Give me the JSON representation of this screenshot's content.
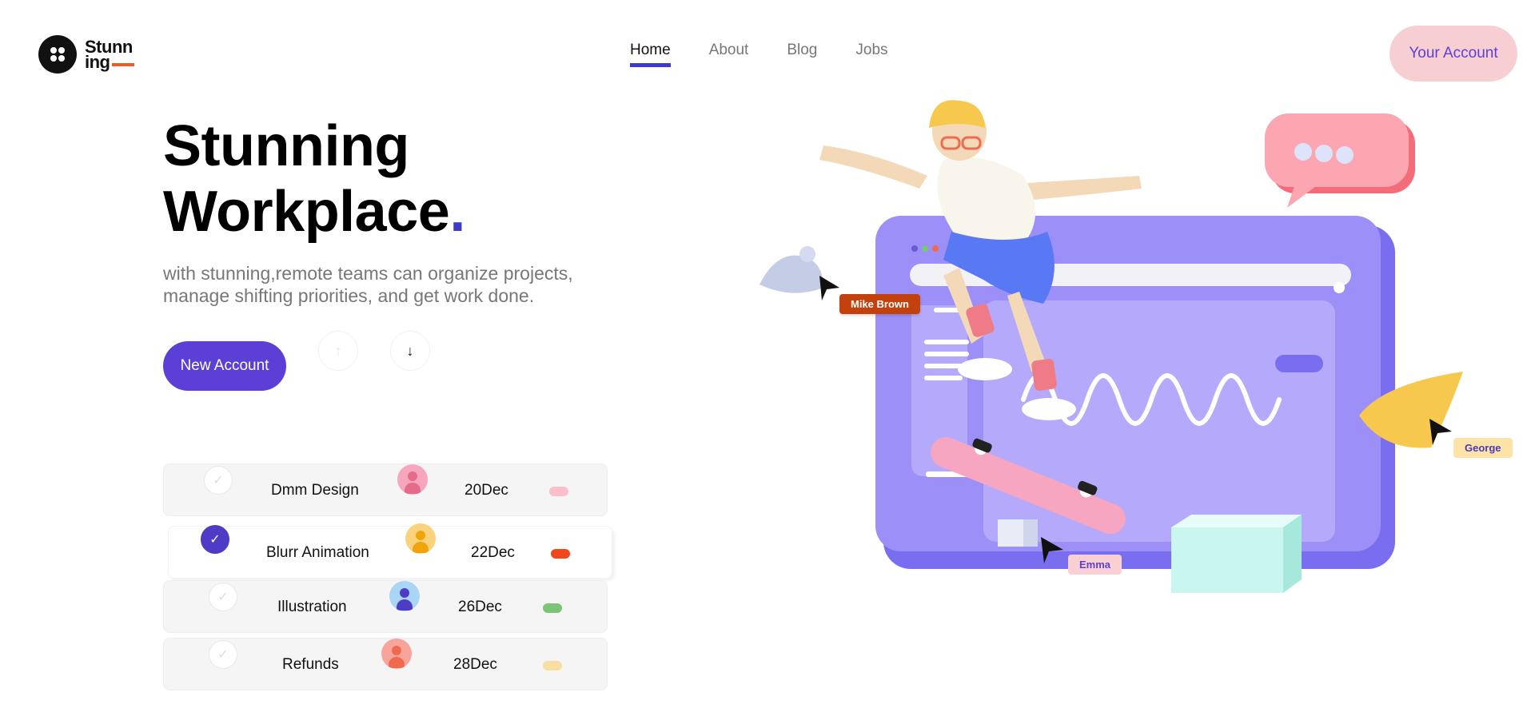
{
  "brand": {
    "line1": "Stunn",
    "line2": "ing"
  },
  "nav": {
    "home": "Home",
    "about": "About",
    "blog": "Blog",
    "jobs": "Jobs"
  },
  "header": {
    "account_label": "Your Account"
  },
  "hero": {
    "title_line1": "Stunning",
    "title_line2": "Workplace",
    "title_dot": ".",
    "subtitle": "with stunning,remote teams can organize projects, manage shifting priorities, and get work done.",
    "cta_label": "New Account",
    "up_arrow": "↑",
    "down_arrow": "↓"
  },
  "tasks": [
    {
      "name": "Dmm Design",
      "date": "20Dec",
      "done": false,
      "avatar_color": "#f7a6bd",
      "pill_color": "#f9c0cc"
    },
    {
      "name": "Blurr Animation",
      "date": "22Dec",
      "done": true,
      "avatar_color": "#fcd37d",
      "pill_color": "#f0471d"
    },
    {
      "name": "Illustration",
      "date": "26Dec",
      "done": false,
      "avatar_color": "#a9d6f5",
      "pill_color": "#7cc576"
    },
    {
      "name": "Refunds",
      "date": "28Dec",
      "done": false,
      "avatar_color": "#f9a49a",
      "pill_color": "#f9dea2"
    }
  ],
  "illustration": {
    "tags": {
      "mike": "Mike Brown",
      "george": "George",
      "emma": "Emma"
    }
  },
  "colors": {
    "primary": "#5b3fd6",
    "accent_underline": "#3d3cc9",
    "account_bg": "#f7cfd2",
    "logo_accent": "#f05a28"
  }
}
